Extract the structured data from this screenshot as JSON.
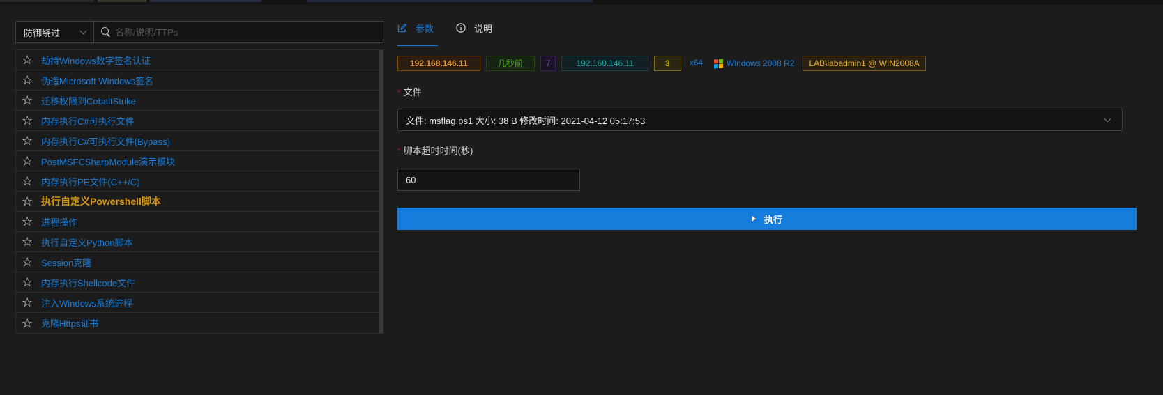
{
  "search": {
    "category_selected": "防御绕过",
    "placeholder": "名称/说明/TTPs"
  },
  "modules": [
    {
      "label": "劫持Windows数字签名认证",
      "active": false
    },
    {
      "label": "伪造Microsoft Windows签名",
      "active": false
    },
    {
      "label": "迁移权限到CobaltStrike",
      "active": false
    },
    {
      "label": "内存执行C#可执行文件",
      "active": false
    },
    {
      "label": "内存执行C#可执行文件(Bypass)",
      "active": false
    },
    {
      "label": "PostMSFCSharpModule演示模块",
      "active": false
    },
    {
      "label": "内存执行PE文件(C++/C)",
      "active": false
    },
    {
      "label": "执行自定义Powershell脚本",
      "active": true
    },
    {
      "label": "进程操作",
      "active": false
    },
    {
      "label": "执行自定义Python脚本",
      "active": false
    },
    {
      "label": "Session克隆",
      "active": false
    },
    {
      "label": "内存执行Shellcode文件",
      "active": false
    },
    {
      "label": "注入Windows系统进程",
      "active": false
    },
    {
      "label": "克隆Https证书",
      "active": false
    }
  ],
  "tabs": {
    "params": "参数",
    "description": "说明"
  },
  "session": {
    "public_ip": "192.168.146.11",
    "last_seen": "几秒前",
    "pid": "7",
    "local_ip": "192.168.146.11",
    "arch_level": "3",
    "arch": "x64",
    "os": "Windows 2008 R2",
    "user": "LAB\\labadmin1 @ WIN2008A"
  },
  "form": {
    "file_label": "文件",
    "file_value": "文件: msflag.ps1 大小: 38 B 修改时间: 2021-04-12 05:17:53",
    "timeout_label": "脚本超时时间(秒)",
    "timeout_value": "60",
    "execute_label": "执行"
  },
  "colors": {
    "accent": "#177ddc",
    "active_item": "#d89614",
    "required": "#a61d24"
  },
  "icons": {
    "star": "star-outline-icon",
    "search": "search-icon",
    "edit": "edit-icon",
    "info": "info-circle-icon",
    "windows": "windows-logo-icon",
    "play": "play-icon"
  }
}
